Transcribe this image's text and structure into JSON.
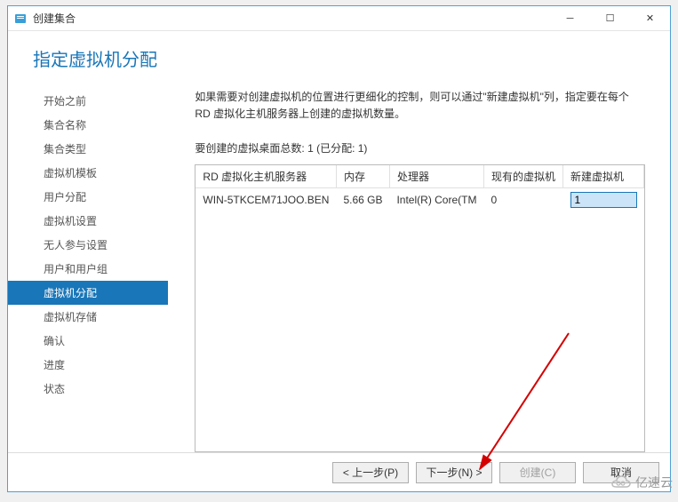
{
  "window": {
    "title": "创建集合"
  },
  "header": {
    "title": "指定虚拟机分配"
  },
  "sidebar": {
    "items": [
      {
        "label": "开始之前"
      },
      {
        "label": "集合名称"
      },
      {
        "label": "集合类型"
      },
      {
        "label": "虚拟机模板"
      },
      {
        "label": "用户分配"
      },
      {
        "label": "虚拟机设置"
      },
      {
        "label": "无人参与设置"
      },
      {
        "label": "用户和用户组"
      },
      {
        "label": "虚拟机分配"
      },
      {
        "label": "虚拟机存储"
      },
      {
        "label": "确认"
      },
      {
        "label": "进度"
      },
      {
        "label": "状态"
      }
    ],
    "activeIndex": 8
  },
  "main": {
    "description": "如果需要对创建虚拟机的位置进行更细化的控制，则可以通过\"新建虚拟机\"列，指定要在每个 RD 虚拟化主机服务器上创建的虚拟机数量。",
    "summary": "要创建的虚拟桌面总数: 1 (已分配: 1)",
    "table": {
      "headers": [
        "RD 虚拟化主机服务器",
        "内存",
        "处理器",
        "现有的虚拟机",
        "新建虚拟机"
      ],
      "rows": [
        {
          "server": "WIN-5TKCEM71JOO.BEN",
          "memory": "5.66 GB",
          "cpu": "Intel(R) Core(TM",
          "existing": "0",
          "new": "1"
        }
      ]
    }
  },
  "footer": {
    "prev": "< 上一步(P)",
    "next": "下一步(N) >",
    "create": "创建(C)",
    "cancel": "取消"
  },
  "watermark": "亿速云"
}
